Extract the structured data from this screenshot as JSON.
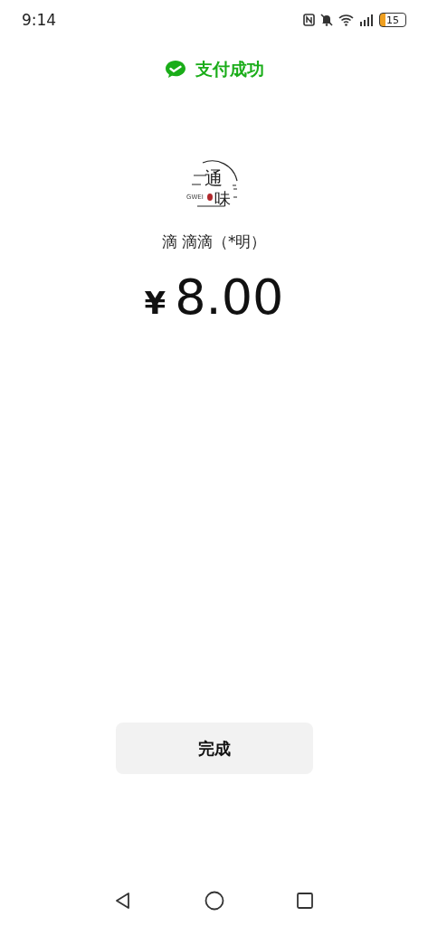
{
  "status_bar": {
    "time": "9:14",
    "battery": "15"
  },
  "header": {
    "title": "支付成功"
  },
  "merchant": {
    "logo_chars": [
      "通",
      "味"
    ],
    "logo_small": "GWEI",
    "name": "滴 滴滴（*明）"
  },
  "payment": {
    "currency": "¥",
    "amount": "8.00"
  },
  "buttons": [
    {
      "label": "完成"
    }
  ]
}
